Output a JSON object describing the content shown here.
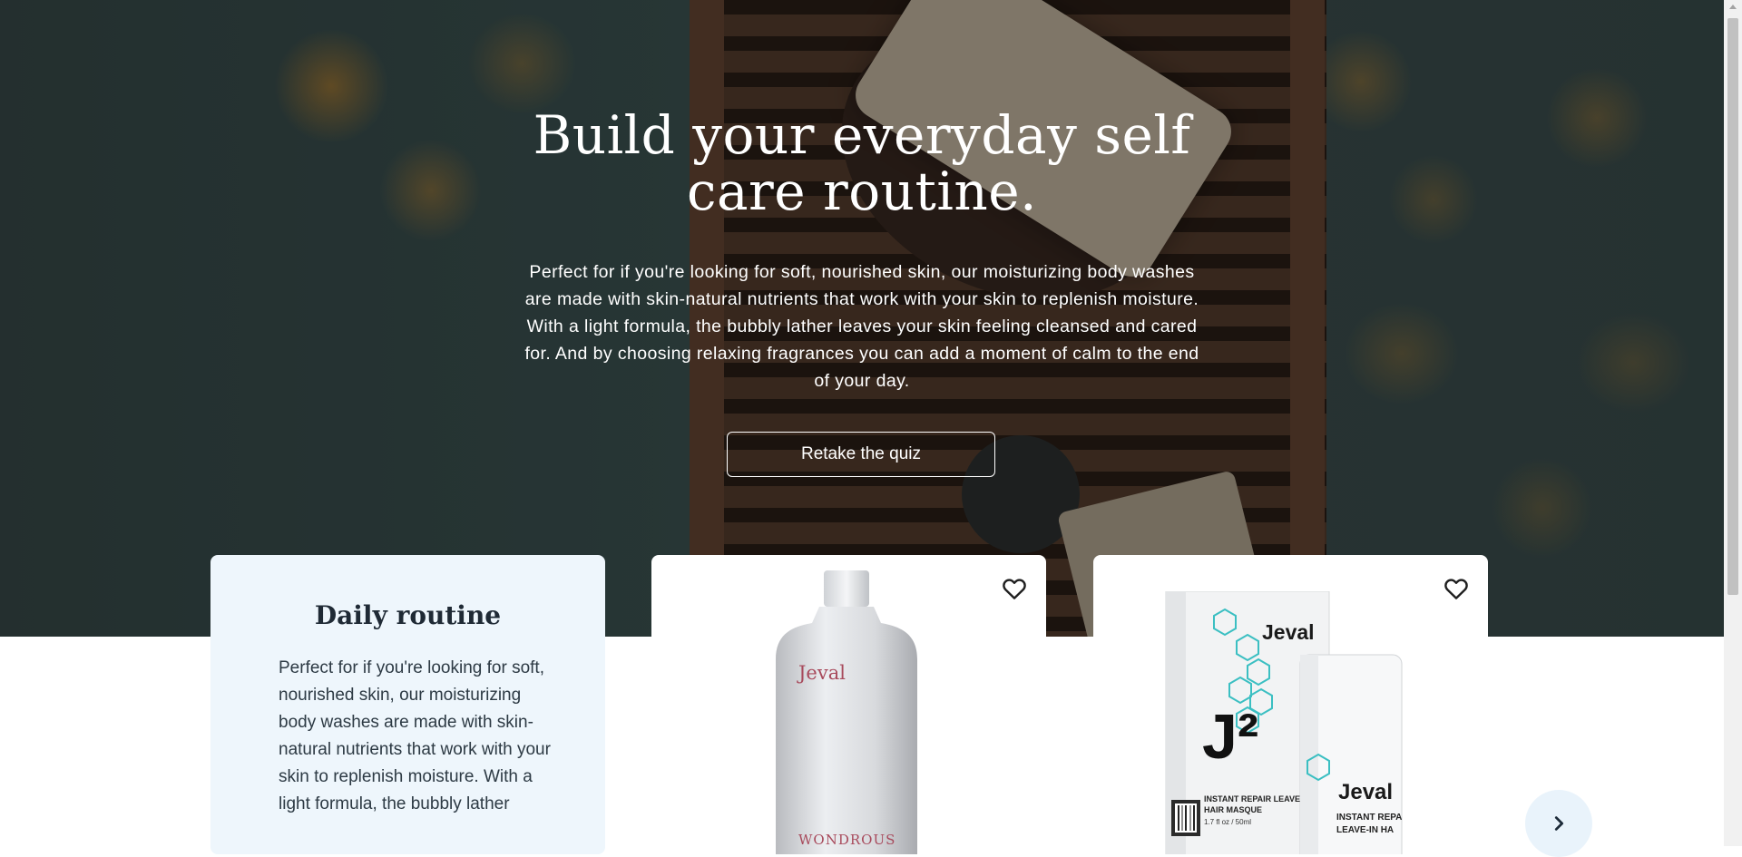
{
  "hero": {
    "title": "Build your everyday self care routine.",
    "description": "Perfect for if you're looking for soft, nourished skin, our moisturizing body washes are made with skin-natural nutrients that work with your skin to replenish moisture. With a light formula, the bubbly lather leaves your skin feeling cleansed and cared for. And by choosing relaxing fragrances you can add a moment of calm to the end of your day.",
    "button_label": "Retake the quiz"
  },
  "routine_card": {
    "title": "Daily routine",
    "description": "Perfect for if you're looking for soft, nourished skin, our moisturizing body washes are made with skin-natural nutrients that work with your skin to replenish moisture. With a light formula, the bubbly lather"
  },
  "products": [
    {
      "brand": "Jeval",
      "name_partial": "WONDROUS",
      "icon": "heart-outline-icon"
    },
    {
      "brand": "Jeval",
      "logo_mark": "J²",
      "package_line1": "INSTANT REPAIR LEAVE",
      "package_line2": "HAIR MASQUE",
      "package_size": "1.7 fl oz / 50ml",
      "bottle_line1": "INSTANT REPA",
      "bottle_line2": "LEAVE-IN HA",
      "icon": "heart-outline-icon"
    }
  ],
  "carousel": {
    "next_icon": "chevron-right-icon"
  },
  "colors": {
    "routine_card_bg": "#eef6fc",
    "next_button_bg": "#e9f3fb",
    "heading_text": "#1f2a35",
    "brand_red": "#a84a5c",
    "brand_teal": "#3bbfc2"
  }
}
